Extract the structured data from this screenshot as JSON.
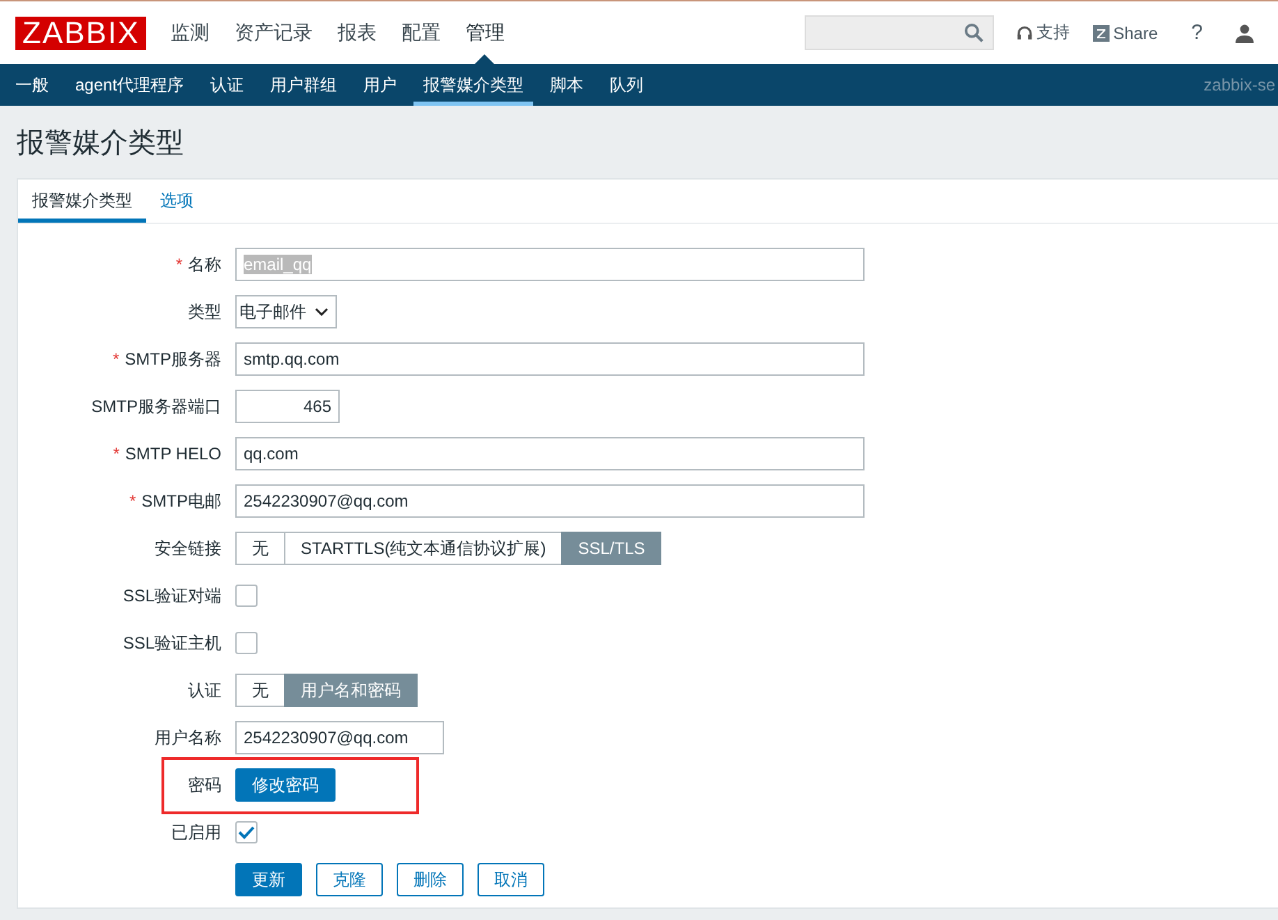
{
  "header": {
    "logo": "ZABBIX",
    "menu": [
      {
        "label": "监测",
        "selected": false
      },
      {
        "label": "资产记录",
        "selected": false
      },
      {
        "label": "报表",
        "selected": false
      },
      {
        "label": "配置",
        "selected": false
      },
      {
        "label": "管理",
        "selected": true
      }
    ],
    "support": "支持",
    "share": "Share",
    "help": "?"
  },
  "subnav": {
    "items": [
      {
        "label": "一般",
        "selected": false
      },
      {
        "label": "agent代理程序",
        "selected": false
      },
      {
        "label": "认证",
        "selected": false
      },
      {
        "label": "用户群组",
        "selected": false
      },
      {
        "label": "用户",
        "selected": false
      },
      {
        "label": "报警媒介类型",
        "selected": true
      },
      {
        "label": "脚本",
        "selected": false
      },
      {
        "label": "队列",
        "selected": false
      }
    ],
    "server": "zabbix-se"
  },
  "page_title": "报警媒介类型",
  "tabs": [
    {
      "label": "报警媒介类型",
      "selected": true
    },
    {
      "label": "选项",
      "selected": false
    }
  ],
  "form": [
    {
      "kind": "text",
      "label": "名称",
      "required_mark": "*",
      "value": "email_qq",
      "value_selected": true
    },
    {
      "kind": "select",
      "label": "类型",
      "value": "电子邮件"
    },
    {
      "kind": "text",
      "label": "SMTP服务器",
      "required_mark": "*",
      "value": "smtp.qq.com",
      "value_selected": false
    },
    {
      "kind": "number",
      "label": "SMTP服务器端口",
      "value": "465"
    },
    {
      "kind": "text",
      "label": "SMTP HELO",
      "required_mark": "*",
      "value": "qq.com",
      "value_selected": false
    },
    {
      "kind": "text",
      "label": "SMTP电邮",
      "required_mark": "*",
      "value": "2542230907@qq.com",
      "value_selected": false
    },
    {
      "kind": "segmented",
      "label": "安全链接",
      "options": [
        {
          "label": "无",
          "selected": false
        },
        {
          "label": "STARTTLS(纯文本通信协议扩展)",
          "selected": false
        },
        {
          "label": "SSL/TLS",
          "selected": true
        }
      ]
    },
    {
      "kind": "checkbox",
      "label": "SSL验证对端",
      "checked": false
    },
    {
      "kind": "checkbox",
      "label": "SSL验证主机",
      "checked": false
    },
    {
      "kind": "segmented",
      "label": "认证",
      "options": [
        {
          "label": "无",
          "selected": false
        },
        {
          "label": "用户名和密码",
          "selected": true
        }
      ]
    },
    {
      "kind": "short_text",
      "label": "用户名称",
      "value": "2542230907@qq.com",
      "value_selected": false
    },
    {
      "kind": "button",
      "label": "密码",
      "button": "修改密码",
      "highlighted": true
    },
    {
      "kind": "checkbox",
      "label": "已启用",
      "checked": true
    }
  ],
  "actions": [
    {
      "label": "更新",
      "primary": true
    },
    {
      "label": "克隆",
      "primary": false
    },
    {
      "label": "删除",
      "primary": false
    },
    {
      "label": "取消",
      "primary": false
    }
  ]
}
